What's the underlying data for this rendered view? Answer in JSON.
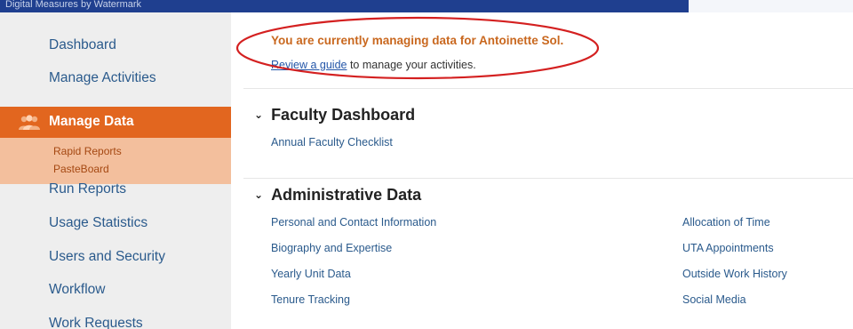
{
  "header": {
    "title": "Digital Measures by Watermark"
  },
  "sidebar": {
    "items_top": [
      "Dashboard",
      "Manage Activities"
    ],
    "active": {
      "label": "Manage Data",
      "icon": "users-icon"
    },
    "subitems": [
      "Rapid Reports",
      "PasteBoard"
    ],
    "items_bottom": [
      "Run Reports",
      "Usage Statistics",
      "Users and Security",
      "Workflow",
      "Work Requests"
    ]
  },
  "notice": {
    "text": "You are currently managing data for Antoinette Sol.",
    "guide_link": "Review a guide",
    "guide_rest": " to manage your activities."
  },
  "sections": {
    "faculty": {
      "title": "Faculty Dashboard",
      "links": [
        "Annual Faculty Checklist"
      ]
    },
    "admin": {
      "title": "Administrative Data",
      "left": [
        "Personal and Contact Information",
        "Biography and Expertise",
        "Yearly Unit Data",
        "Tenure Tracking"
      ],
      "right": [
        "Allocation of Time",
        "UTA Appointments",
        "Outside Work History",
        "Social Media"
      ]
    }
  },
  "colors": {
    "accent": "#e2661f",
    "nav_text": "#2a5a8c",
    "annotation": "#d42020"
  }
}
